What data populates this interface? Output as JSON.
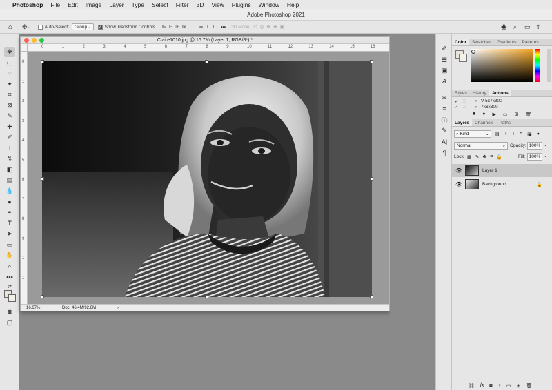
{
  "menubar": {
    "items": [
      "Photoshop",
      "File",
      "Edit",
      "Image",
      "Layer",
      "Type",
      "Select",
      "Filter",
      "3D",
      "View",
      "Plugins",
      "Window",
      "Help"
    ]
  },
  "app": {
    "title": "Adobe Photoshop 2021"
  },
  "options_bar": {
    "auto_select_label": "Auto-Select:",
    "auto_select_value": "Group",
    "show_transform_label": "Show Transform Controls",
    "mode_3d_label": "3D Mode:",
    "more_label": "•••"
  },
  "document": {
    "title": "Claire1010.jpg @ 16.7% (Layer 1, RGB/8*) *",
    "zoom": "16.67%",
    "doc_size": "Doc: 46.4M/92.8M",
    "h_ruler": [
      "0",
      "1",
      "2",
      "3",
      "4",
      "5",
      "6",
      "7",
      "8",
      "9",
      "10",
      "11",
      "12",
      "13",
      "14",
      "15",
      "16"
    ],
    "v_ruler": [
      "0",
      "1",
      "2",
      "3",
      "4",
      "5",
      "6",
      "7",
      "8",
      "9",
      "1",
      "1",
      "1"
    ]
  },
  "panels": {
    "color_tabs": [
      "Color",
      "Swatches",
      "Gradients",
      "Patterns"
    ],
    "actions_tabs": [
      "Styles",
      "History",
      "Actions"
    ],
    "actions_items": [
      "V 5x7x300",
      "7x6x300"
    ],
    "layers_tabs": [
      "Layers",
      "Channels",
      "Paths"
    ],
    "kind_label": "Kind",
    "blend_mode": "Normal",
    "opacity_label": "Opacity:",
    "opacity_value": "100%",
    "lock_label": "Lock:",
    "fill_label": "Fill:",
    "fill_value": "100%",
    "layers": [
      {
        "name": "Layer 1",
        "selected": true
      },
      {
        "name": "Background",
        "selected": false,
        "locked": true
      }
    ]
  },
  "colors": {
    "accent_orange": "#f5a623",
    "panel_bg": "#e6e6e6",
    "pasteboard": "#8a8a8a"
  }
}
